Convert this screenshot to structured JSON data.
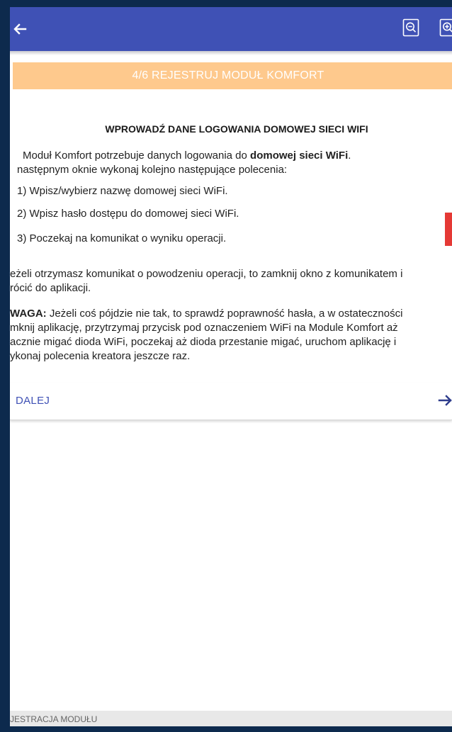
{
  "header": {
    "back_icon": "arrow-left-icon",
    "zoom_out_icon": "zoom-out-icon",
    "zoom_in_icon": "zoom-in-icon",
    "bar_color": "#3f51b5"
  },
  "step_banner": {
    "label": "4/6 REJESTRUJ MODUŁ KOMFORT",
    "color": "#fec98d"
  },
  "content": {
    "heading": "WPROWADŹ DANE LOGOWANIA DOMOWEJ SIECI WIFI",
    "intro_line1_prefix": "Moduł Komfort potrzebuje danych logowania do ",
    "intro_line1_bold": "domowej sieci WiFi",
    "intro_line1_suffix": ".",
    "intro_line2": "następnym oknie wykonaj kolejno następujące polecenia:",
    "steps": [
      "1) Wpisz/wybierz nazwę domowej sieci WiFi.",
      "2) Wpisz hasło dostępu do domowej sieci WiFi.",
      "3) Poczekaj na komunikat o wyniku operacji."
    ],
    "success_line1": "eżeli otrzymasz komunikat o powodzeniu operacji, to zamknij okno z komunikatem i",
    "success_line2": "rócić do aplikacji.",
    "warning_label": "WAGA:",
    "warning_line1_rest": " Jeżeli coś pójdzie nie tak, to sprawdź poprawność hasła, a w ostateczności",
    "warning_line2": "mknij aplikację, przytrzymaj przycisk pod oznaczeniem WiFi na Module Komfort aż",
    "warning_line3": "acznie migać dioda WiFi, poczekaj aż dioda przestanie migać, uruchom aplikację i",
    "warning_line4": "ykonaj polecenia kreatora jeszcze raz."
  },
  "next_button": {
    "label": "DALEJ",
    "icon": "arrow-right-icon"
  },
  "footer": {
    "label": "JESTRACJA MODUŁU"
  }
}
